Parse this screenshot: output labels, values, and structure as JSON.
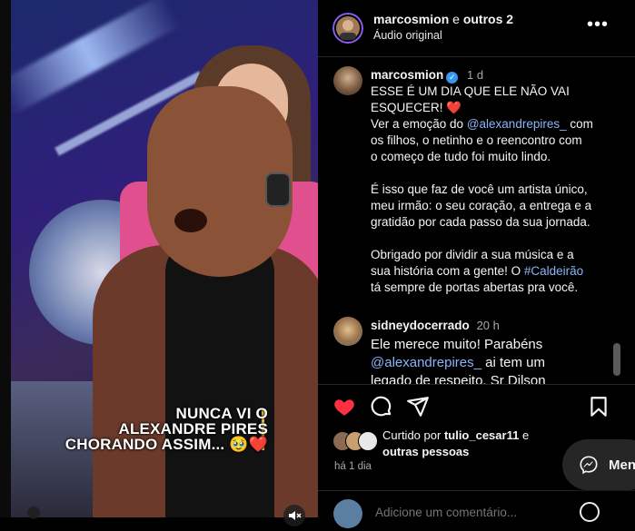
{
  "post": {
    "author": "marcosmion",
    "header_connector": "e",
    "header_others": "outros 2",
    "audio_label": "Áudio original",
    "more_label": "•••"
  },
  "video": {
    "caption_line1": "NUNCA VI O",
    "caption_line2": "ALEXANDRE PIRES",
    "caption_line3": "CHORANDO ASSIM... 🥹❤️"
  },
  "caption_comment": {
    "username": "marcosmion",
    "time": "1 d",
    "line1": "ESSE É UM DIA QUE ELE NÃO VAI",
    "line2": "ESQUECER! ❤️",
    "p1_before": "Ver a emoção do ",
    "p1_mention": "@alexandrepires_",
    "p1_after_1": " com",
    "p1_l2": "os filhos, o netinho e o reencontro com",
    "p1_l3": "o começo de tudo foi muito lindo.",
    "p2_l1": "É isso que faz de você um artista único,",
    "p2_l2": "meu irmão: o seu coração, a entrega e a",
    "p2_l3": "gratidão por cada passo da sua jornada.",
    "p3_l1": "Obrigado por dividir a sua música e a",
    "p3_l2_before": "sua história com a gente! O ",
    "p3_hashtag": "#Caldeirão",
    "p3_l3": "tá sempre de portas abertas pra você."
  },
  "comment2": {
    "username": "sidneydocerrado",
    "time": "20 h",
    "line1": "Ele merece muito! Parabéns",
    "mention": "@alexandrepires_",
    "line2_after": " ai tem um",
    "line3": "legado de respeito. Sr Dilson"
  },
  "likes": {
    "prefix": "Curtido por",
    "user": "tulio_cesar11",
    "connector": "e",
    "others": "outras pessoas"
  },
  "timestamp": "há 1 dia",
  "comment_input": {
    "placeholder": "Adicione um comentário..."
  },
  "messages": {
    "label": "Men"
  },
  "colors": {
    "like_red": "#ff3040",
    "link_blue": "#8ab4f8",
    "verified_blue": "#3897f0"
  }
}
